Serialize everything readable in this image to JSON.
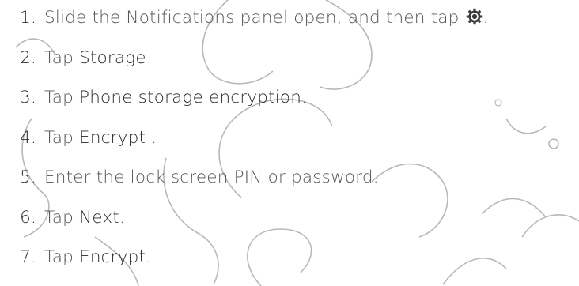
{
  "steps": [
    {
      "number": "1.",
      "pre": "Slide the Notifications panel open, and then tap",
      "em": "",
      "post": ".",
      "icon": "gear-icon"
    },
    {
      "number": "2.",
      "pre": "Tap",
      "em": "Storage",
      "post": "."
    },
    {
      "number": "3.",
      "pre": "Tap",
      "em": "Phone storage encryption",
      "post": "."
    },
    {
      "number": "4.",
      "pre": "Tap",
      "em": "Encrypt",
      "post": " ."
    },
    {
      "number": "5.",
      "pre": "Enter the lock screen PIN or password.",
      "em": "",
      "post": ""
    },
    {
      "number": "6.",
      "pre": "Tap",
      "em": "Next",
      "post": "."
    },
    {
      "number": "7.",
      "pre": "Tap",
      "em": "Encrypt",
      "post": "."
    }
  ],
  "colors": {
    "text": "#555555",
    "emphasis": "#2a2a2a",
    "watermark": "#b0b0b0"
  }
}
